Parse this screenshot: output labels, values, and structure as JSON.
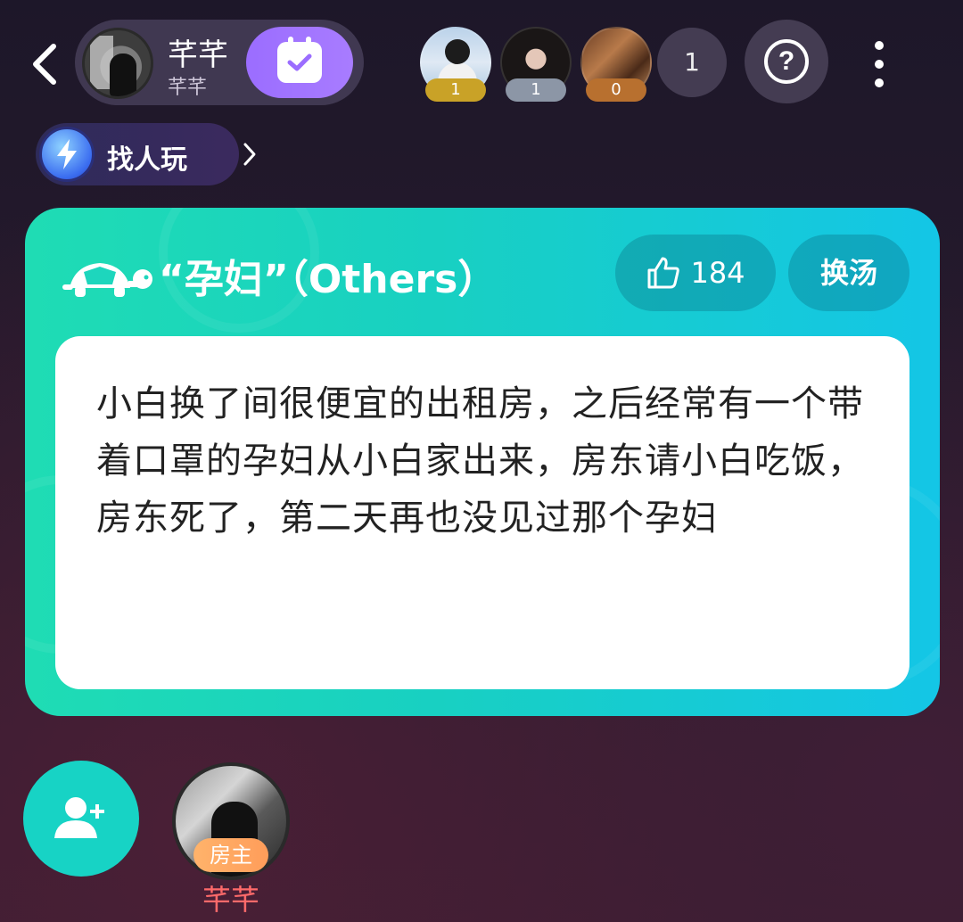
{
  "header": {
    "back_icon": "chevron-left-icon",
    "room_name": "芊芊",
    "room_sub": "芊芊",
    "checkin_icon": "calendar-check-icon",
    "members": [
      {
        "score": "1",
        "badge_color": "#c9a227"
      },
      {
        "score": "1",
        "badge_color": "#8c96a6"
      },
      {
        "score": "0",
        "badge_color": "#b8702f"
      }
    ],
    "member_count": "1",
    "help_label": "?",
    "more_icon": "more-vertical-icon"
  },
  "find": {
    "label": "找人玩",
    "chevron": "›",
    "icon": "lightning-icon"
  },
  "card": {
    "title": "“孕妇”（Others）",
    "icon": "turtle-icon",
    "like_icon": "thumbs-up-icon",
    "like_count": "184",
    "swap_label": "换汤",
    "story": "小白换了间很便宜的出租房，之后经常有一个带着口罩的孕妇从小白家出来，房东请小白吃饭，房东死了，第二天再也没见过那个孕妇",
    "gradient_start": "#1fdcb4",
    "gradient_end": "#14c6e6"
  },
  "bottom": {
    "invite_icon": "add-user-icon",
    "host_badge": "房主",
    "host_name": "芊芊"
  }
}
